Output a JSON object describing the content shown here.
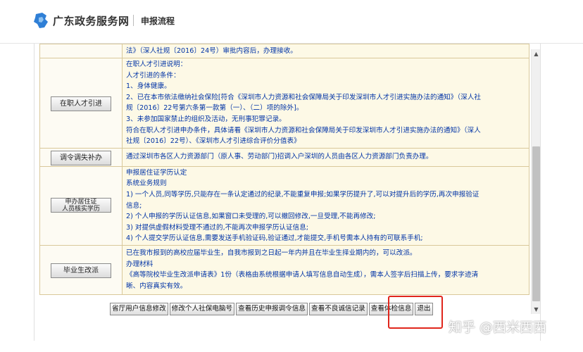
{
  "header": {
    "site_name": "广东政务服务网",
    "breadcrumb": "申报流程"
  },
  "rows": [
    {
      "label": "",
      "lines": [
        "法》（深人社规〔2016〕24号）审批内容后，办理接收。"
      ]
    },
    {
      "label": "在职人才引进",
      "lines": [
        "在职人才引进说明：",
        "人才引进的条件：",
        "1、身体健康。",
        "2、已在本市依法缴纳社会保险[符合《深圳市人力资源和社会保障局关于印发深圳市人才引进实施办法的通知》（深人社",
        "规〔2016〕22号第六条第一款第（一）、（二）项的除外]。",
        "3、未参加国家禁止的组织及活动，无刑事犯罪记录。",
        "符合在职人才引进申办条件，具体请看《深圳市人力资源和社会保障局关于印发深圳市人才引进实施办法的通知》（深人",
        "社规〔2016〕22号）、《深圳市人才引进综合评价分值表》"
      ]
    },
    {
      "label": "调令调失补办",
      "lines": [
        "通过深圳市各区人力资源部门（原人事、劳动部门)招调入户深圳的人员由各区人力资源部门负责办理。"
      ]
    },
    {
      "label": "申办居住证人员核实学历",
      "label_lines": [
        "申办居住证",
        "人员核实学历"
      ],
      "lines": [
        "申报居住证学历认定",
        "系统业务规则",
        "  1) 一个人员,同等学历,只能存在一条认定通过的纪录,不能重复申报;如果学历提升了,可以对提升后的学历,再次申报验证",
        "信息;",
        "  2) 个人申报的学历认证信息,如果窗口未受理的,可以撤回修改,一旦受理,不能再修改;",
        "  3) 对提供虚假材料受理不通过的,不能再次申报学历认证信息;",
        "  4) 个人提交学历认证信息,需要发送手机验证码,验证通过,才能提交,手机号需本人持有的可联系手机;"
      ]
    },
    {
      "label": "毕业生改派",
      "lines": [
        "已在我市报到的高校应届毕业生，自我市报到之日起一年内并且在毕业生择业期内的，可以改派。",
        "办理材料",
        "《高等院校毕业生改派申请表》1份（表格由系统根据申请人填写信息自动生成），需本人签字后扫描上传，要求字迹清",
        "晰、内容真实有效。"
      ]
    }
  ],
  "buttons": [
    "省厅用户信息修改",
    "修改个人社保电脑号",
    "查看历史申报调令信息",
    "查看不良诚信记录",
    "查看体检信息",
    "退出"
  ],
  "watermark": "知乎 @西米西西",
  "colors": {
    "link_text": "#0033a6",
    "cell_bg": "#fdf9e6",
    "border": "#d9c89a",
    "highlight": "#e0261c",
    "logo": "#2f7fd6"
  },
  "icons": {
    "logo": "guangdong-gov-logo-icon",
    "scroll_up": "scroll-up-arrow-icon",
    "scroll_down": "scroll-down-arrow-icon"
  }
}
